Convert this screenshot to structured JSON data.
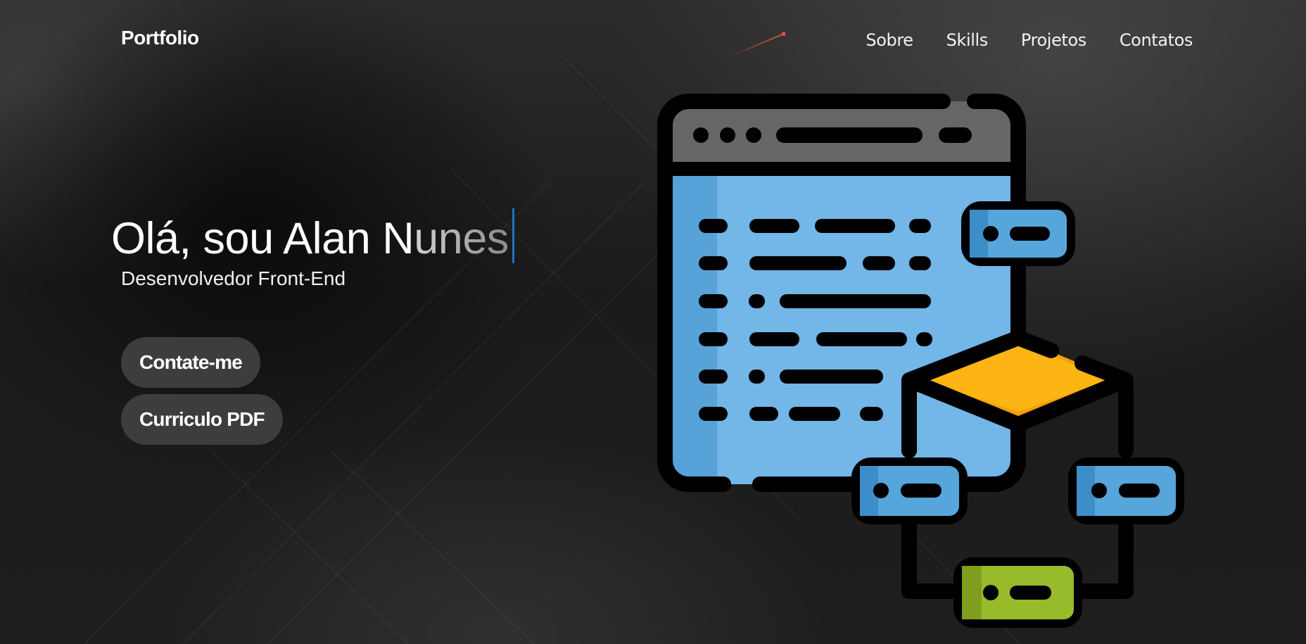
{
  "brand": {
    "logo_text": "Portfolio"
  },
  "nav": {
    "items": [
      {
        "label": "Sobre"
      },
      {
        "label": "Skills"
      },
      {
        "label": "Projetos"
      },
      {
        "label": "Contatos"
      }
    ]
  },
  "hero": {
    "title_main": "Olá, sou Alan N",
    "title_tail": "unes",
    "subtitle": "Desenvolvedor Front-End"
  },
  "buttons": {
    "contact_label": "Contate-me",
    "cv_label": "Curriculo PDF"
  },
  "illustration": {
    "icon": "web-development-flowchart-icon",
    "colors": {
      "window_header": "#666666",
      "window_body": "#73b6e8",
      "window_side": "#56a2d9",
      "cube_top": "#fcb513",
      "node_blue": "#56a6dc",
      "node_green": "#97bb2b",
      "outline": "#000000"
    }
  },
  "colors": {
    "background": "#1c1c1c",
    "button_bg": "#3d3d3d",
    "caret": "#1e73c8",
    "meteor": "#e0553a"
  }
}
